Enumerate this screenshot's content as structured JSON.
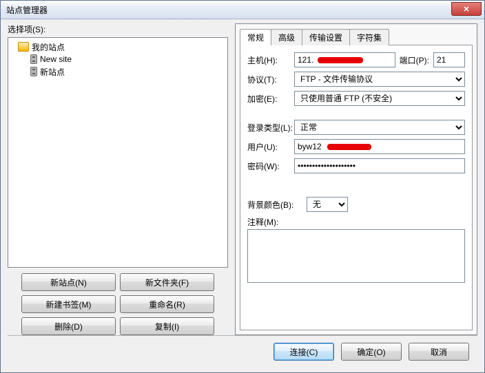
{
  "title": "站点管理器",
  "left_label": "选择项(S):",
  "tree": {
    "root": "我的站点",
    "items": [
      "New site",
      "新站点"
    ]
  },
  "left_buttons": {
    "new_site": "新站点(N)",
    "new_folder": "新文件夹(F)",
    "new_bookmark": "新建书签(M)",
    "rename": "重命名(R)",
    "delete": "删除(D)",
    "copy": "复制(I)"
  },
  "tabs": [
    "常规",
    "高级",
    "传输设置",
    "字符集"
  ],
  "active_tab": 0,
  "form": {
    "host_label": "主机(H):",
    "host_value": "121.",
    "port_label": "端口(P):",
    "port_value": "21",
    "protocol_label": "协议(T):",
    "protocol_value": "FTP - 文件传输协议",
    "encryption_label": "加密(E):",
    "encryption_value": "只使用普通 FTP (不安全)",
    "logon_label": "登录类型(L):",
    "logon_value": "正常",
    "user_label": "用户(U):",
    "user_value": "byw12",
    "pass_label": "密码(W):",
    "pass_value": "••••••••••••••••••••",
    "bg_label": "背景颜色(B):",
    "bg_value": "无",
    "notes_label": "注释(M):",
    "notes_value": ""
  },
  "bottom": {
    "connect": "连接(C)",
    "ok": "确定(O)",
    "cancel": "取消"
  }
}
